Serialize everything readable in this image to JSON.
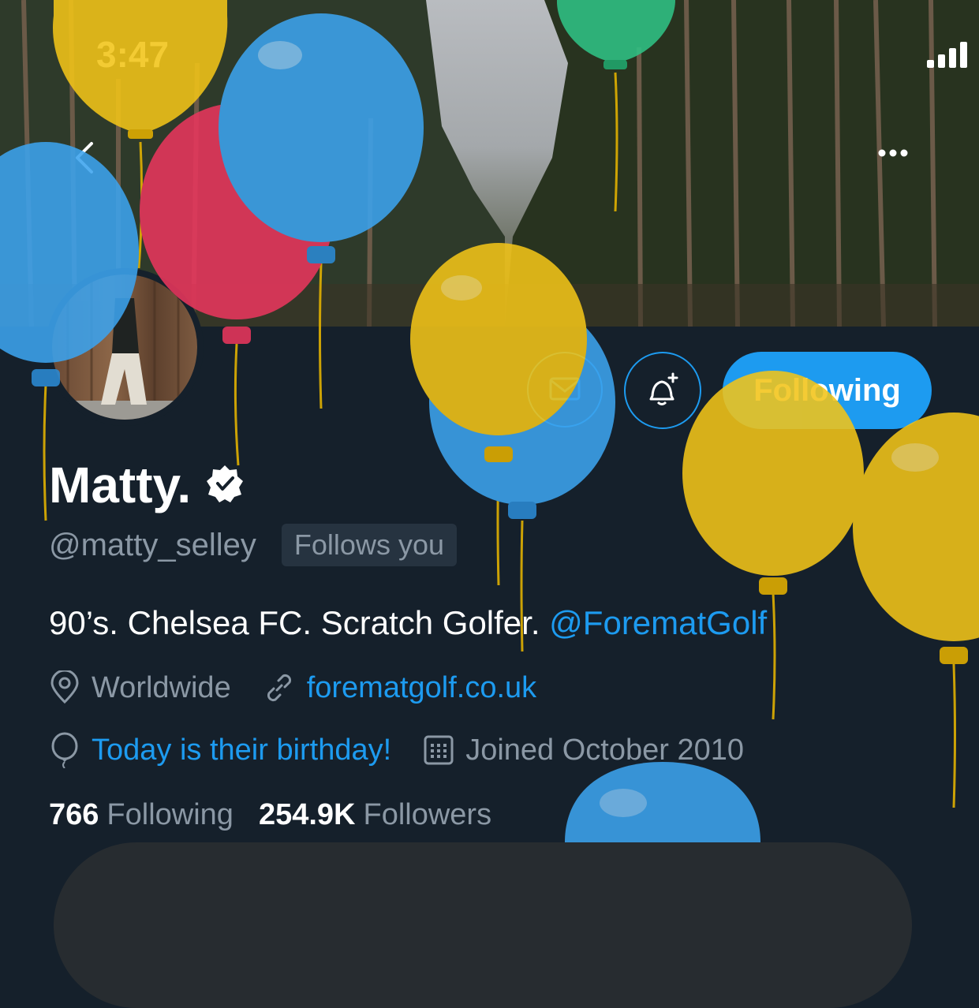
{
  "status_bar": {
    "time": "3:47"
  },
  "profile": {
    "name": "Matty.",
    "handle": "@matty_selley",
    "follows_you": "Follows you",
    "bio_text": "90’s. Chelsea FC. Scratch Golfer. ",
    "bio_mention": "@ForematGolf",
    "location": "Worldwide",
    "website": "forematgolf.co.uk",
    "birthday": "Today is their birthday!",
    "joined": "Joined October 2010",
    "following_count": "766",
    "following_label": "Following",
    "followers_count": "254.9K",
    "followers_label": "Followers"
  },
  "actions": {
    "follow_state": "Following"
  },
  "colors": {
    "accent": "#1d9bf0",
    "background": "#15202b",
    "muted": "#8b98a5"
  },
  "icons": [
    "back-icon",
    "more-icon",
    "message-icon",
    "bell-plus-icon",
    "verified-icon",
    "location-icon",
    "link-icon",
    "balloon-icon",
    "calendar-icon"
  ]
}
